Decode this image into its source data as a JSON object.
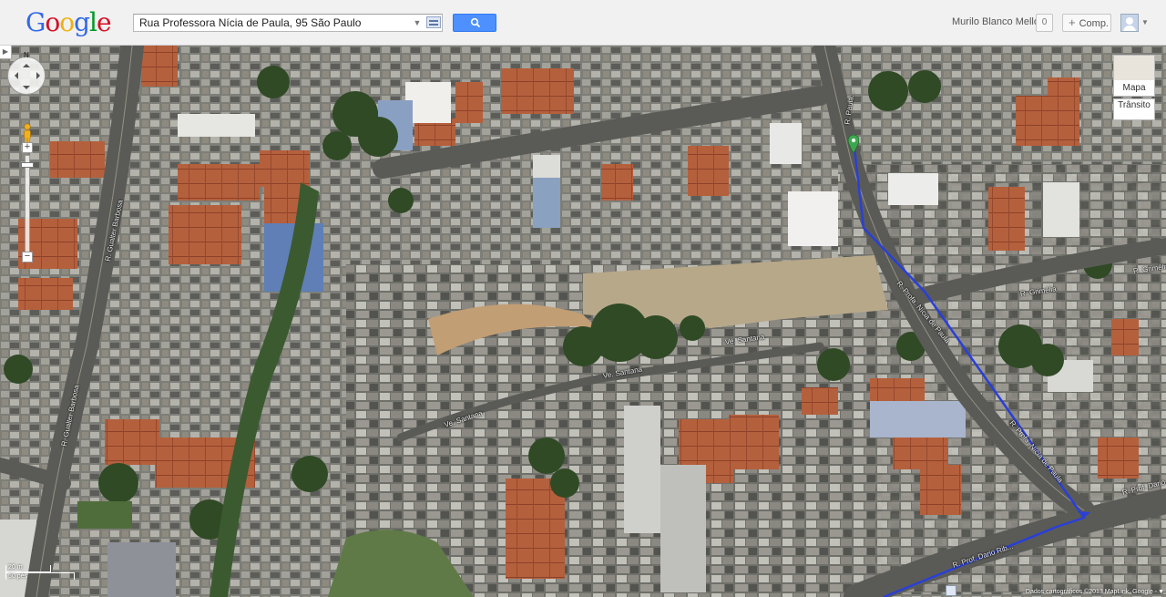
{
  "logo": {
    "letters": [
      "G",
      "o",
      "o",
      "g",
      "l",
      "e"
    ],
    "colors": [
      "#3369e8",
      "#d50f25",
      "#eeb211",
      "#3369e8",
      "#009925",
      "#d50f25"
    ]
  },
  "search": {
    "value": "Rua Professora Nícia de Paula, 95 São Paulo"
  },
  "user": {
    "name": "Murilo Blanco Mello",
    "notifications": "0",
    "share_label": "Comp."
  },
  "map": {
    "layer_thumb_label": "Mapa",
    "traffic_label": "Trânsito",
    "street_labels": [
      {
        "text": "R. Gualter Barbosa"
      },
      {
        "text": "R. Gualter Barbosa"
      },
      {
        "text": "R. Grimélia"
      },
      {
        "text": "R. Grimélia"
      },
      {
        "text": "Ve. Santana"
      },
      {
        "text": "Ve. Santana"
      },
      {
        "text": "Ve. Santana"
      },
      {
        "text": "R. Profa. Nícia de Paula"
      },
      {
        "text": "R. Profa. Nícia de Paula"
      },
      {
        "text": "R. Prof. Dario"
      },
      {
        "text": "R. Prof. Dario Rib..."
      },
      {
        "text": "R. Paula..."
      }
    ],
    "scale": {
      "top": "20 m",
      "bottom": "50 pés"
    },
    "attribution": "Dados cartográficos ©2013 MapLink, Google -",
    "route_color": "#2a3fd8",
    "pin_color": "#3ea650"
  }
}
